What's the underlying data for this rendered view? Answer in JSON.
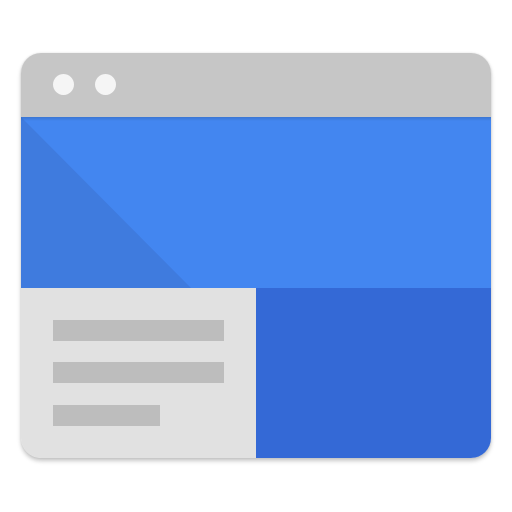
{
  "app_icon": {
    "name": "browser-window-icon",
    "colors": {
      "titlebar": "#c6c6c6",
      "dots": "#f5f5f5",
      "header_light": "#4386f0",
      "header_dark": "#3f7bde",
      "document_panel": "#e1e1e1",
      "document_lines": "#bdbdbd",
      "media_panel": "#3469d6"
    },
    "titlebar": {
      "dot_count": 2
    },
    "document": {
      "line_count": 3
    }
  }
}
